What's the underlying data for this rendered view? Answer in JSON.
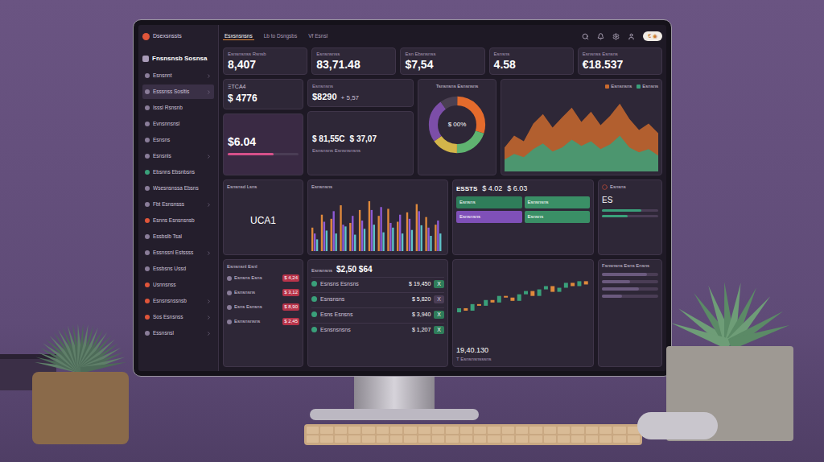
{
  "topbar": {
    "brand": "Dsexsnssts",
    "nav": [
      {
        "label": "Esxsnsnsns",
        "selected": true
      },
      {
        "label": "Lb to Dsngsbs",
        "selected": false
      },
      {
        "label": "Vf Esnsl",
        "selected": false
      }
    ],
    "button": "€ ◉"
  },
  "sidebar": {
    "title": "Fnsnsnsb Sosnsa",
    "items": [
      {
        "label": "Esnsnnt",
        "selected": false,
        "expandable": true,
        "color": "#8a7d99"
      },
      {
        "label": "Esssnss Sosltis",
        "selected": true,
        "expandable": true,
        "color": "#8a7d99"
      },
      {
        "label": "Isssl Rsnsnb",
        "selected": false,
        "expandable": false,
        "color": "#8a7d99"
      },
      {
        "label": "Evnsnnsnsl",
        "selected": false,
        "expandable": false,
        "color": "#8a7d99"
      },
      {
        "label": "Esnsns",
        "selected": false,
        "expandable": false,
        "color": "#8a7d99"
      },
      {
        "label": "Esnsnls",
        "selected": false,
        "expandable": true,
        "color": "#8a7d99"
      },
      {
        "label": "Ebsnns Ebsnbsns",
        "selected": false,
        "expandable": false,
        "color": "#3aa07a"
      },
      {
        "label": "Wsesnsnssa Ebsns",
        "selected": false,
        "expandable": false,
        "color": "#8a7d99"
      },
      {
        "label": "Fbt Esnsnsss",
        "selected": false,
        "expandable": true,
        "color": "#8a7d99"
      },
      {
        "label": "Esnns Esnsnsnsb",
        "selected": false,
        "expandable": false,
        "color": "#e0553a"
      },
      {
        "label": "Essbslb Tsal",
        "selected": false,
        "expandable": false,
        "color": "#8a7d99"
      },
      {
        "label": "Essnssnl Estssss",
        "selected": false,
        "expandable": true,
        "color": "#8a7d99"
      },
      {
        "label": "Essbsns Ussd",
        "selected": false,
        "expandable": false,
        "color": "#8a7d99"
      },
      {
        "label": "Usnnsnss",
        "selected": false,
        "expandable": false,
        "color": "#e0553a"
      },
      {
        "label": "Esnsnsnssnsb",
        "selected": false,
        "expandable": true,
        "color": "#e0553a"
      },
      {
        "label": "Sos Esnsnss",
        "selected": false,
        "expandable": true,
        "color": "#e0553a"
      },
      {
        "label": "Essnsnsl",
        "selected": false,
        "expandable": true,
        "color": "#8a7d99"
      }
    ]
  },
  "stats": [
    {
      "label": "Esnsnsnss Rsnsb",
      "value": "8,407"
    },
    {
      "label": "Esnsnsnss",
      "value": "83,71.48"
    },
    {
      "label": "Esn Ebsnsnss",
      "value": "$7,54"
    },
    {
      "label": "Esnsns",
      "value": "4.58"
    },
    {
      "label": "Esnsnss Esnsns",
      "value": "€18.537"
    }
  ],
  "coin": {
    "label": "ΞTCA4",
    "value": "$ 4776"
  },
  "rate": {
    "label": "Esnsnsns",
    "value": "$8290",
    "change": "+ 5,57"
  },
  "balance": {
    "value": "$6.04",
    "level": 0.65
  },
  "pair": {
    "first": "$ 81,55C",
    "second": "$ 37,07",
    "note": "Esnsnsns Esnsnsnsns"
  },
  "donut": {
    "title": "Tsnsnsns Esnsnsns",
    "center": "$ 00%",
    "segments": [
      {
        "value": 30,
        "color": "#e46b2c"
      },
      {
        "value": 20,
        "color": "#5fb370"
      },
      {
        "value": 15,
        "color": "#d3b54a"
      },
      {
        "value": 25,
        "color": "#7c4ea8"
      },
      {
        "value": 10,
        "color": "#4a4052"
      }
    ]
  },
  "area": {
    "series": [
      {
        "name": "Esnsnsns",
        "color": "#c96a2e",
        "values": [
          30,
          45,
          38,
          60,
          72,
          55,
          68,
          80,
          62,
          75,
          58,
          70,
          85,
          66,
          52,
          60,
          48
        ]
      },
      {
        "name": "Esnsns",
        "color": "#3aa07a",
        "values": [
          15,
          22,
          18,
          28,
          35,
          25,
          30,
          40,
          32,
          38,
          28,
          34,
          45,
          30,
          24,
          28,
          20
        ]
      }
    ]
  },
  "map": {
    "title": "Esnsnsd Lsns",
    "value": "UCA1"
  },
  "bars": {
    "title": "Esnsnsns",
    "series": [
      {
        "color": "#e08a3c",
        "values": [
          40,
          62,
          55,
          78,
          48,
          70,
          85,
          60,
          72,
          50,
          66,
          80,
          58,
          45
        ]
      },
      {
        "color": "#8f5bd6",
        "values": [
          30,
          50,
          68,
          45,
          60,
          52,
          70,
          75,
          48,
          62,
          55,
          68,
          40,
          52
        ]
      },
      {
        "color": "#5fc4c9",
        "values": [
          20,
          35,
          30,
          42,
          28,
          38,
          45,
          32,
          40,
          30,
          36,
          44,
          26,
          30
        ]
      }
    ]
  },
  "tiles": {
    "title": "ESSTS",
    "value": "$ 4.02",
    "value2": "$ 6.03",
    "chips": [
      {
        "label": "Esnsns",
        "color": "#2f7d5a"
      },
      {
        "label": "Esnsnsns",
        "color": "#3a8f66"
      },
      {
        "label": "Esnsnsns",
        "color": "#7f50b8"
      },
      {
        "label": "Esnsns",
        "color": "#3a8f66"
      }
    ]
  },
  "side": {
    "title": "Esnsns",
    "value": "ES",
    "items": [
      {
        "level": 0.7
      },
      {
        "level": 0.45
      }
    ]
  },
  "list": {
    "title": "Esnsnsnl Esnl",
    "rows": [
      {
        "name": "Esnsns Esns",
        "value": "$ 4,24"
      },
      {
        "name": "Esnsnsns",
        "value": "$ 3,12"
      },
      {
        "name": "Esns Esnsns",
        "value": "$ 8,90"
      },
      {
        "name": "Esnsnsnsns",
        "value": "$ 2,45"
      }
    ]
  },
  "table": {
    "title": "Esnsnsns",
    "value": "$2,50 $64",
    "rows": [
      {
        "name": "Esnsns Esnsns",
        "value": "$ 19,450",
        "status": "X",
        "positive": true
      },
      {
        "name": "Esnsnsns",
        "value": "$ 5,820",
        "status": "X",
        "positive": false
      },
      {
        "name": "Esns Esnsns",
        "value": "$ 3,940",
        "status": "X",
        "positive": true
      },
      {
        "name": "Esnsnsnsns",
        "value": "$ 1,207",
        "status": "X",
        "positive": true
      }
    ]
  },
  "candles": {
    "value": "19,40.130",
    "footer": "T Esnsnsnsssns",
    "open": [
      40,
      45,
      42,
      50,
      48,
      55,
      52,
      60,
      58,
      54,
      62,
      66,
      60,
      68,
      72,
      65,
      70,
      76,
      72,
      78
    ],
    "close": [
      45,
      42,
      50,
      48,
      55,
      52,
      60,
      58,
      54,
      62,
      66,
      60,
      68,
      72,
      65,
      70,
      76,
      72,
      78,
      74
    ]
  },
  "progress": {
    "title": "Fsnsnsns Esns Ensns",
    "items": [
      {
        "level": 0.8
      },
      {
        "level": 0.5
      },
      {
        "level": 0.65
      },
      {
        "level": 0.35
      }
    ]
  }
}
